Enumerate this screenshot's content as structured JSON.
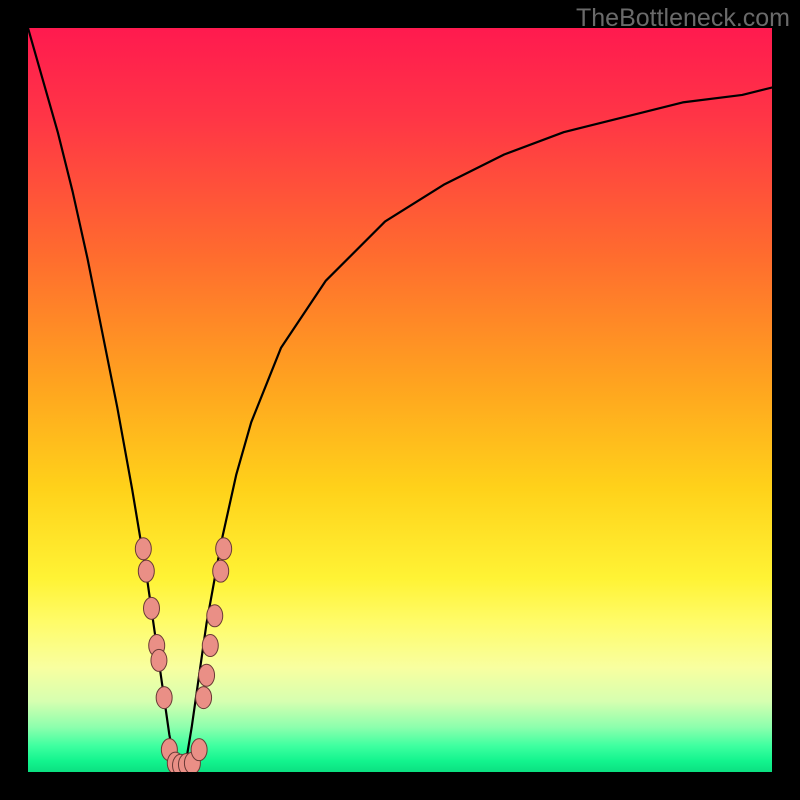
{
  "watermark": "TheBottleneck.com",
  "colors": {
    "frame": "#000000",
    "curve_stroke": "#000000",
    "marker_fill": "#ea8f86",
    "marker_stroke": "#6a3a36",
    "gradient_stops": [
      {
        "offset": 0.0,
        "color": "#ff1a4f"
      },
      {
        "offset": 0.12,
        "color": "#ff3546"
      },
      {
        "offset": 0.3,
        "color": "#ff6a2f"
      },
      {
        "offset": 0.48,
        "color": "#ffa41f"
      },
      {
        "offset": 0.62,
        "color": "#ffd21a"
      },
      {
        "offset": 0.74,
        "color": "#fff335"
      },
      {
        "offset": 0.8,
        "color": "#fffc6a"
      },
      {
        "offset": 0.86,
        "color": "#f8ffa0"
      },
      {
        "offset": 0.905,
        "color": "#d6ffb0"
      },
      {
        "offset": 0.94,
        "color": "#8cffad"
      },
      {
        "offset": 0.965,
        "color": "#3effa0"
      },
      {
        "offset": 0.985,
        "color": "#13f48e"
      },
      {
        "offset": 1.0,
        "color": "#0be081"
      }
    ]
  },
  "chart_data": {
    "type": "line",
    "title": "",
    "xlabel": "",
    "ylabel": "",
    "xlim": [
      0,
      100
    ],
    "ylim": [
      0,
      100
    ],
    "grid": false,
    "legend": false,
    "series": [
      {
        "name": "bottleneck-curve",
        "x": [
          0,
          2,
          4,
          6,
          8,
          10,
          12,
          14,
          16,
          17,
          18,
          19,
          20,
          21,
          22,
          23,
          24,
          26,
          28,
          30,
          34,
          40,
          48,
          56,
          64,
          72,
          80,
          88,
          96,
          100
        ],
        "y": [
          100,
          93,
          86,
          78,
          69,
          59,
          49,
          38,
          26,
          19,
          12,
          5,
          0,
          0,
          6,
          13,
          20,
          31,
          40,
          47,
          57,
          66,
          74,
          79,
          83,
          86,
          88,
          90,
          91,
          92
        ]
      }
    ],
    "markers": {
      "name": "highlighted-points",
      "points": [
        {
          "x": 15.5,
          "y": 30
        },
        {
          "x": 15.9,
          "y": 27
        },
        {
          "x": 16.6,
          "y": 22
        },
        {
          "x": 17.3,
          "y": 17
        },
        {
          "x": 17.6,
          "y": 15
        },
        {
          "x": 18.3,
          "y": 10
        },
        {
          "x": 19.0,
          "y": 3.0
        },
        {
          "x": 19.8,
          "y": 1.2
        },
        {
          "x": 20.5,
          "y": 0.9
        },
        {
          "x": 21.3,
          "y": 1.0
        },
        {
          "x": 22.1,
          "y": 1.2
        },
        {
          "x": 23.0,
          "y": 3.0
        },
        {
          "x": 23.6,
          "y": 10
        },
        {
          "x": 24.0,
          "y": 13
        },
        {
          "x": 24.5,
          "y": 17
        },
        {
          "x": 25.1,
          "y": 21
        },
        {
          "x": 25.9,
          "y": 27
        },
        {
          "x": 26.3,
          "y": 30
        }
      ]
    },
    "minimum_x": 20.6
  }
}
